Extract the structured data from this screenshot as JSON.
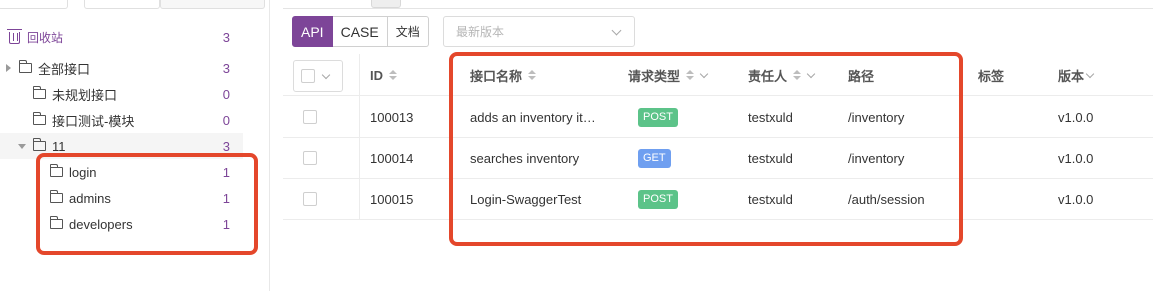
{
  "sidebar": {
    "trash": {
      "label": "回收站",
      "count": "3"
    },
    "tree": [
      {
        "label": "全部接口",
        "count": "3"
      },
      {
        "label": "未规划接口",
        "count": "0"
      },
      {
        "label": "接口测试-模块",
        "count": "0"
      },
      {
        "label": "11",
        "count": "3"
      },
      {
        "label": "login",
        "count": "1"
      },
      {
        "label": "admins",
        "count": "1"
      },
      {
        "label": "developers",
        "count": "1"
      }
    ]
  },
  "toolbar": {
    "tabs": [
      "API",
      "CASE",
      "文档"
    ],
    "version_placeholder": "最新版本"
  },
  "table": {
    "headers": {
      "id": "ID",
      "name": "接口名称",
      "method": "请求类型",
      "owner": "责任人",
      "path": "路径",
      "tags": "标签",
      "version": "版本"
    },
    "rows": [
      {
        "id": "100013",
        "name": "adds an inventory it…",
        "method": "POST",
        "owner": "testxuld",
        "path": "/inventory",
        "version": "v1.0.0"
      },
      {
        "id": "100014",
        "name": "searches inventory",
        "method": "GET",
        "owner": "testxuld",
        "path": "/inventory",
        "version": "v1.0.0"
      },
      {
        "id": "100015",
        "name": "Login-SwaggerTest",
        "method": "POST",
        "owner": "testxuld",
        "path": "/auth/session",
        "version": "v1.0.0"
      }
    ]
  },
  "colors": {
    "accent": "#7d4598",
    "post": "#5cc389",
    "get": "#6f9ff0",
    "highlight": "#e4472b"
  }
}
